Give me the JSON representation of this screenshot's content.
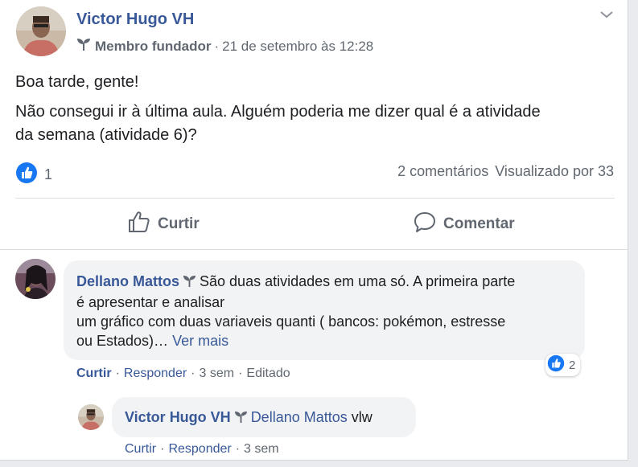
{
  "post": {
    "author": "Victor Hugo VH",
    "badge": "Membro fundador",
    "separator": "·",
    "timestamp": "21 de setembro às 12:28",
    "paragraphs": [
      "Boa tarde, gente!",
      "Não consegui ir à última aula. Alguém poderia me dizer qual é a atividade",
      "da semana (atividade 6)?"
    ],
    "likes": "1",
    "comments_count": "2 comentários",
    "viewed_by": "Visualizado por 33",
    "actions": {
      "like": "Curtir",
      "comment": "Comentar"
    }
  },
  "comments": [
    {
      "author": "Dellano Mattos",
      "lines": [
        "São duas atividades em uma só. A primeira parte",
        "é apresentar e analisar",
        "um gráfico com duas variaveis quanti ( bancos: pokémon, estresse",
        "ou Estados)…"
      ],
      "see_more": "Ver mais",
      "reactions": "2",
      "actions": {
        "like": "Curtir",
        "reply": "Responder",
        "time": "3 sem",
        "edited": "Editado"
      }
    },
    {
      "author": "Victor Hugo VH",
      "mention": "Dellano Mattos",
      "text": "vlw",
      "actions": {
        "like": "Curtir",
        "reply": "Responder",
        "time": "3 sem"
      }
    }
  ],
  "colors": {
    "link": "#385898",
    "secondary_text": "#606770",
    "like_blue": "#1877f2",
    "bubble": "#f2f3f5"
  },
  "icons": [
    "sprout-icon",
    "chevron-down-icon",
    "like-badge-icon",
    "thumbs-up-icon",
    "speech-bubble-icon"
  ]
}
